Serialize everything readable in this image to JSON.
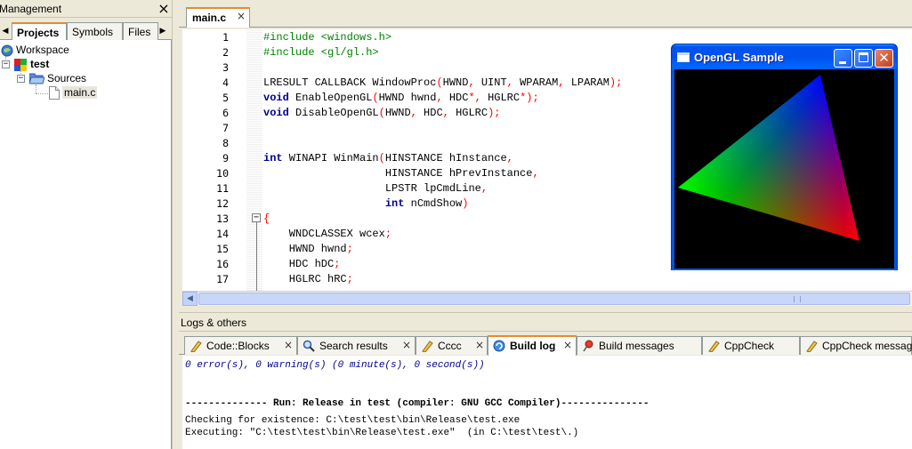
{
  "management": {
    "title": "Management",
    "close": "×",
    "tabs": [
      "Projects",
      "Symbols",
      "Files"
    ],
    "active_tab": "Projects",
    "tree": {
      "workspace": "Workspace",
      "project": "test",
      "folder": "Sources",
      "file": "main.c"
    }
  },
  "editor": {
    "tab_label": "main.c",
    "tab_close": "×",
    "lines": [
      {
        "n": "1",
        "html": "<span class=\"pp\">#include &lt;windows.h&gt;</span>"
      },
      {
        "n": "2",
        "html": "<span class=\"pp\">#include &lt;gl/gl.h&gt;</span>"
      },
      {
        "n": "3",
        "html": ""
      },
      {
        "n": "4",
        "html": "LRESULT CALLBACK WindowProc<span class=\"op\">(</span>HWND<span class=\"op\">,</span> UINT<span class=\"op\">,</span> WPARAM<span class=\"op\">,</span> LPARAM<span class=\"op\">);</span>"
      },
      {
        "n": "5",
        "html": "<span class=\"kw\">void</span> EnableOpenGL<span class=\"op\">(</span>HWND hwnd<span class=\"op\">,</span> HDC<span class=\"op\">*,</span> HGLRC<span class=\"op\">*);</span>"
      },
      {
        "n": "6",
        "html": "<span class=\"kw\">void</span> DisableOpenGL<span class=\"op\">(</span>HWND<span class=\"op\">,</span> HDC<span class=\"op\">,</span> HGLRC<span class=\"op\">);</span>"
      },
      {
        "n": "7",
        "html": ""
      },
      {
        "n": "8",
        "html": ""
      },
      {
        "n": "9",
        "html": "<span class=\"kw\">int</span> WINAPI WinMain<span class=\"op\">(</span>HINSTANCE hInstance<span class=\"op\">,</span>"
      },
      {
        "n": "10",
        "html": "                   HINSTANCE hPrevInstance<span class=\"op\">,</span>"
      },
      {
        "n": "11",
        "html": "                   LPSTR lpCmdLine<span class=\"op\">,</span>"
      },
      {
        "n": "12",
        "html": "                   <span class=\"kw\">int</span> nCmdShow<span class=\"op\">)</span>"
      },
      {
        "n": "13",
        "html": "<span class=\"op\">{</span>"
      },
      {
        "n": "14",
        "html": "    WNDCLASSEX wcex<span class=\"op\">;</span>"
      },
      {
        "n": "15",
        "html": "    HWND hwnd<span class=\"op\">;</span>"
      },
      {
        "n": "16",
        "html": "    HDC hDC<span class=\"op\">;</span>"
      },
      {
        "n": "17",
        "html": "    HGLRC hRC<span class=\"op\">;</span>"
      }
    ],
    "fold_marker": "−"
  },
  "opengl_window": {
    "title": "OpenGL Sample",
    "close": "✕",
    "triangle_colors": {
      "top": "#0000ff",
      "left": "#00ff00",
      "bottom": "#ff0000"
    }
  },
  "logs": {
    "title": "Logs & others",
    "tabs": [
      {
        "label": "Code::Blocks",
        "icon": "codeblocks-icon"
      },
      {
        "label": "Search results",
        "icon": "search-icon"
      },
      {
        "label": "Cccc",
        "icon": "pencil-icon"
      },
      {
        "label": "Build log",
        "icon": "build-log-icon"
      },
      {
        "label": "Build messages",
        "icon": "pin-icon"
      },
      {
        "label": "CppCheck",
        "icon": "pencil-icon"
      },
      {
        "label": "CppCheck messages",
        "icon": "pencil-icon"
      }
    ],
    "active_tab": "Build log",
    "tab_close": "×",
    "output": [
      "0 error(s), 0 warning(s) (0 minute(s), 0 second(s))",
      "",
      "",
      "-------------- Run: Release in test (compiler: GNU GCC Compiler)---------------",
      "Checking for existence: C:\\test\\test\\bin\\Release\\test.exe",
      "Executing: \"C:\\test\\test\\bin\\Release\\test.exe\"  (in C:\\test\\test\\.)"
    ]
  },
  "colors": {
    "tab_accent": "#e68b2c",
    "xp_title_blue": "#0055e5",
    "keyword": "#00008b",
    "preprocessor": "#008000",
    "operator": "#ff0000"
  }
}
